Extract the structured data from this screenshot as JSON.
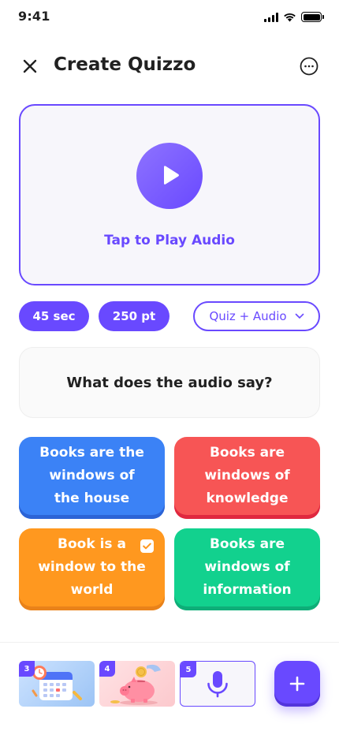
{
  "status_bar": {
    "time": "9:41"
  },
  "header": {
    "title": "Create Quizzo"
  },
  "audio": {
    "label": "Tap to Play Audio"
  },
  "chips": {
    "time": "45 sec",
    "points": "250 pt",
    "type": "Quiz + Audio"
  },
  "question": {
    "text": "What does the audio say?"
  },
  "answers": [
    {
      "text": "Books are the windows of the house",
      "color": "#3B82F6",
      "correct": false
    },
    {
      "text": "Books are windows of knowledge",
      "color": "#F75555",
      "correct": false
    },
    {
      "text": "Book is a window to the world",
      "color": "#FF981F",
      "correct": true
    },
    {
      "text": "Books are windows of information",
      "color": "#12D18E",
      "correct": false
    }
  ],
  "slides": [
    {
      "number": "3",
      "icon": "calendar-alarm-illustration"
    },
    {
      "number": "4",
      "icon": "piggy-bank-illustration"
    },
    {
      "number": "5",
      "icon": "microphone-icon",
      "selected": true
    }
  ],
  "colors": {
    "primary": "#6949FF"
  }
}
